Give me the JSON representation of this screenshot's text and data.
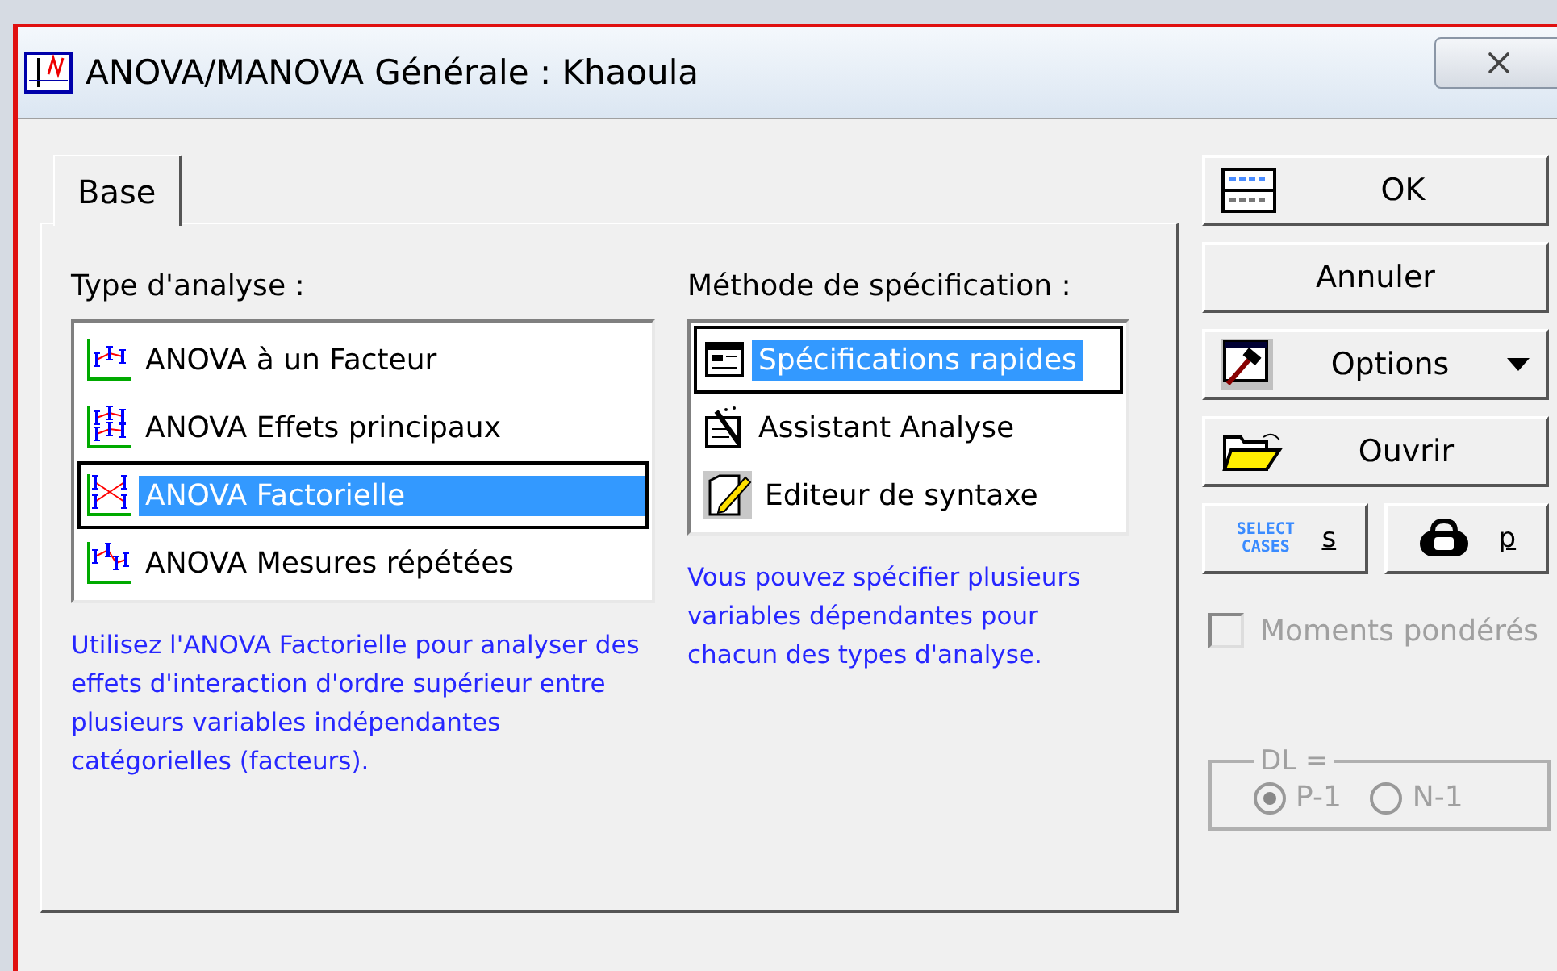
{
  "window": {
    "title": "ANOVA/MANOVA Générale : Khaoula"
  },
  "tabs": [
    {
      "label": "Base",
      "selected": true
    }
  ],
  "analysis_type": {
    "label": "Type d'analyse :",
    "items": [
      {
        "label": "ANOVA à un Facteur",
        "selected": false,
        "kind": "oneway"
      },
      {
        "label": "ANOVA Effets principaux",
        "selected": false,
        "kind": "main"
      },
      {
        "label": "ANOVA Factorielle",
        "selected": true,
        "kind": "factorial"
      },
      {
        "label": "ANOVA Mesures répétées",
        "selected": false,
        "kind": "repeated"
      }
    ],
    "description": "Utilisez l'ANOVA Factorielle pour analyser des effets d'interaction d'ordre supérieur entre plusieurs variables indépendantes catégorielles (facteurs)."
  },
  "specification_method": {
    "label": "Méthode de spécification :",
    "items": [
      {
        "label": "Spécifications rapides",
        "selected": true,
        "kind": "quick"
      },
      {
        "label": "Assistant Analyse",
        "selected": false,
        "kind": "wizard"
      },
      {
        "label": "Editeur de syntaxe",
        "selected": false,
        "kind": "syntax"
      }
    ],
    "description": "Vous pouvez spécifier plusieurs variables dépendantes pour chacun des types d'analyse."
  },
  "buttons": [
    {
      "label": "OK",
      "kind": "ok"
    },
    {
      "label": "Annuler",
      "kind": "cancel"
    },
    {
      "label": "Options",
      "kind": "options"
    },
    {
      "label": "Ouvrir",
      "kind": "open"
    }
  ],
  "small_buttons": [
    {
      "label": "s",
      "icon_text": "SELECT CASES"
    },
    {
      "label": "p"
    }
  ],
  "weighted_moments": {
    "label": "Moments pondérés",
    "checked": false,
    "disabled": true
  },
  "dl_group": {
    "label": "DL =",
    "disabled": true,
    "options": [
      {
        "label": "P-1",
        "selected": true
      },
      {
        "label": "N-1",
        "selected": false
      }
    ]
  }
}
